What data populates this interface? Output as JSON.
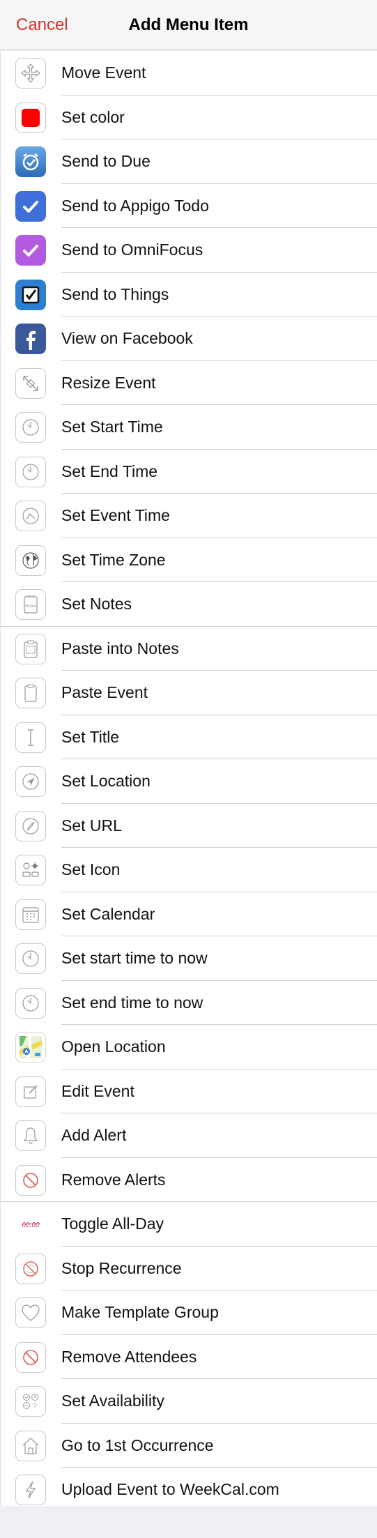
{
  "navbar": {
    "cancel_label": "Cancel",
    "title": "Add Menu Item"
  },
  "colors": {
    "accent": "#d0312d",
    "set_color_swatch": "#ff0000"
  },
  "items": [
    {
      "label": "Move Event",
      "icon": "move-icon"
    },
    {
      "label": "Set color",
      "icon": "color-swatch-icon"
    },
    {
      "label": "Send to Due",
      "icon": "due-app-icon"
    },
    {
      "label": "Send to Appigo Todo",
      "icon": "appigo-todo-icon"
    },
    {
      "label": "Send to OmniFocus",
      "icon": "omnifocus-icon"
    },
    {
      "label": "Send to Things",
      "icon": "things-icon"
    },
    {
      "label": "View on Facebook",
      "icon": "facebook-icon"
    },
    {
      "label": "Resize Event",
      "icon": "resize-icon"
    },
    {
      "label": "Set Start Time",
      "icon": "clock-icon"
    },
    {
      "label": "Set End Time",
      "icon": "clock-icon"
    },
    {
      "label": "Set Event Time",
      "icon": "clock-range-icon"
    },
    {
      "label": "Set Time Zone",
      "icon": "globe-icon"
    },
    {
      "label": "Set Notes",
      "icon": "notes-icon",
      "notes_text": "Notes"
    },
    {
      "label": "Paste into Notes",
      "icon": "paste-notes-icon"
    },
    {
      "label": "Paste Event",
      "icon": "clipboard-icon"
    },
    {
      "label": "Set Title",
      "icon": "text-cursor-icon"
    },
    {
      "label": "Set Location",
      "icon": "location-arrow-icon"
    },
    {
      "label": "Set URL",
      "icon": "compass-icon"
    },
    {
      "label": "Set Icon",
      "icon": "icon-grid-icon"
    },
    {
      "label": "Set Calendar",
      "icon": "calendar-icon"
    },
    {
      "label": "Set start time to now",
      "icon": "clock-icon"
    },
    {
      "label": "Set end time to now",
      "icon": "clock-icon"
    },
    {
      "label": "Open Location",
      "icon": "maps-app-icon"
    },
    {
      "label": "Edit Event",
      "icon": "edit-icon"
    },
    {
      "label": "Add Alert",
      "icon": "bell-icon"
    },
    {
      "label": "Remove Alerts",
      "icon": "prohibited-icon"
    },
    {
      "label": "Toggle All-Day",
      "icon": "all-day-toggle-icon",
      "glyph_text": "00:00"
    },
    {
      "label": "Stop Recurrence",
      "icon": "stop-recurrence-icon"
    },
    {
      "label": "Make Template Group",
      "icon": "heart-icon"
    },
    {
      "label": "Remove Attendees",
      "icon": "prohibited-icon"
    },
    {
      "label": "Set Availability",
      "icon": "availability-icon"
    },
    {
      "label": "Go to 1st Occurrence",
      "icon": "home-icon"
    },
    {
      "label": "Upload Event to WeekCal.com",
      "icon": "lightning-icon"
    }
  ]
}
